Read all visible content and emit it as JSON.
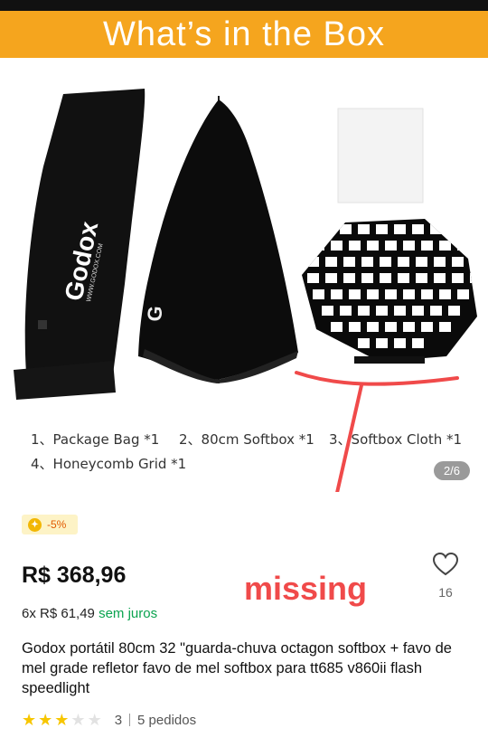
{
  "banner": {
    "title": "What’s in the Box"
  },
  "image": {
    "brand": "Godox",
    "url_text": "WWW.GODOX.COM",
    "captions": [
      "1、Package Bag *1",
      "2、80cm Softbox *1",
      "3、Softbox Cloth *1",
      "4、Honeycomb Grid *1"
    ],
    "counter": "2/6",
    "annotation": "missing"
  },
  "discount_badge": {
    "text": "-5%",
    "icon": "coin-icon"
  },
  "price": "R$ 368,96",
  "installments": {
    "prefix": "6x R$ 61,49",
    "suffix": "sem juros"
  },
  "wishlist": {
    "count": "16",
    "icon": "heart-icon"
  },
  "product_title": "Godox portátil 80cm 32 \"guarda-chuva octagon softbox + favo de mel grade refletor favo de mel softbox para tt685 v860ii flash speedlight",
  "rating": {
    "stars_filled": 3,
    "stars_total": 5,
    "score": "3",
    "orders": "5 pedidos"
  },
  "colors": {
    "banner": "#f5a51e",
    "annotation": "#f04a4a",
    "green": "#0aa34f",
    "star": "#f7c600"
  }
}
